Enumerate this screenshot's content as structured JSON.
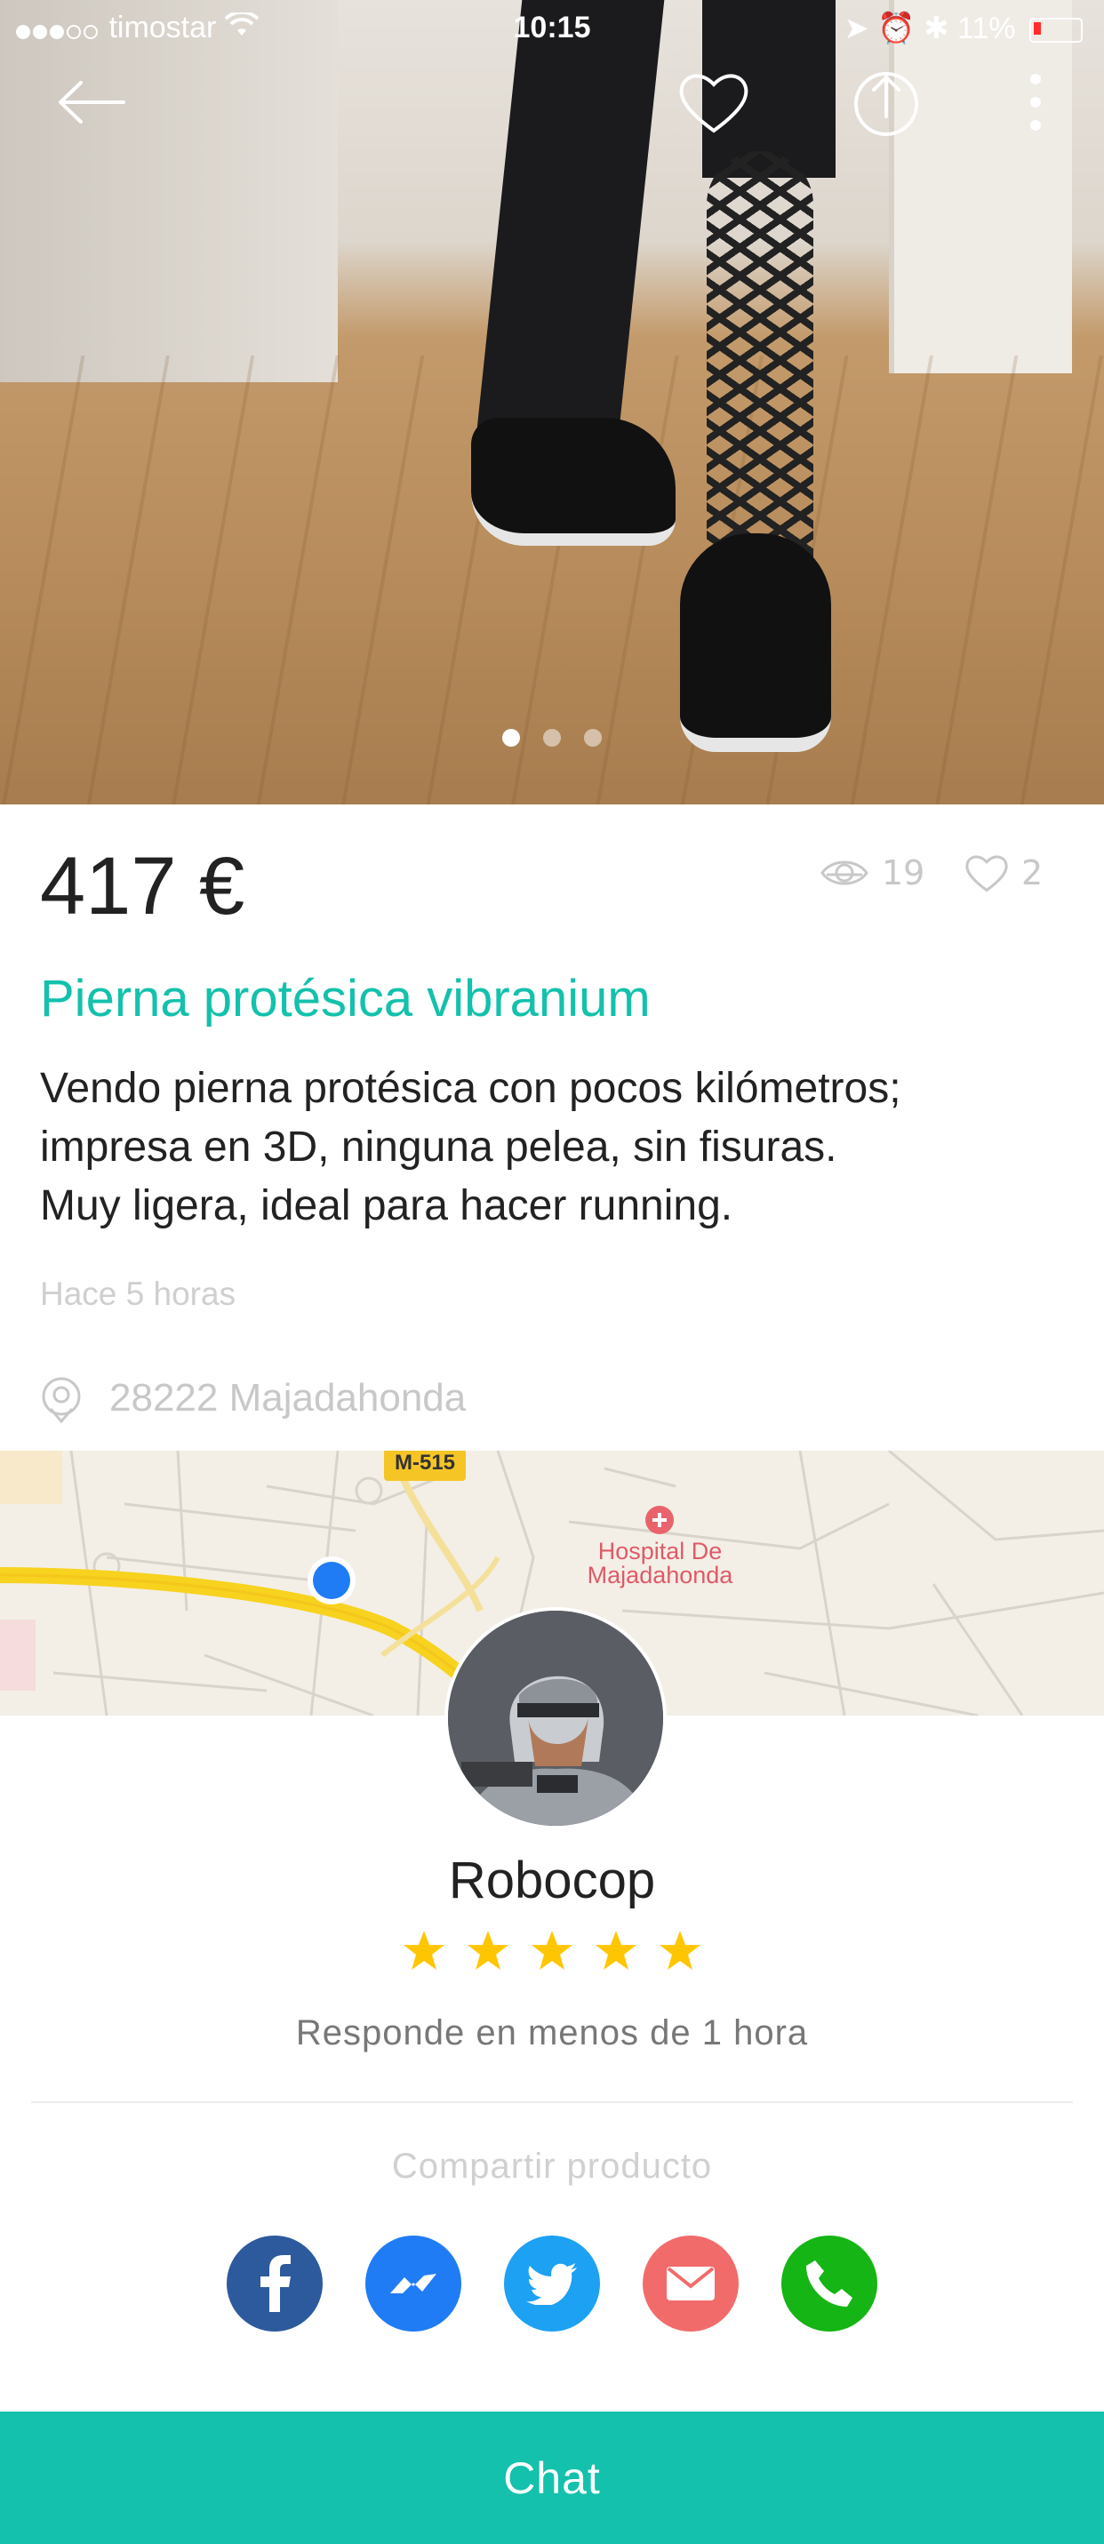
{
  "status_bar": {
    "carrier": "timostar",
    "time": "10:15",
    "battery": "11%"
  },
  "gallery": {
    "image_count": 3,
    "active_index": 0
  },
  "listing": {
    "price": "417 €",
    "views": "19",
    "likes": "2",
    "title": "Pierna protésica vibranium",
    "description_lines": [
      "Vendo pierna protésica con pocos kilómetros;",
      "impresa en 3D, ninguna pelea, sin fisuras.",
      "Muy ligera, ideal para hacer running."
    ],
    "posted": "Hace 5 horas",
    "location": "28222 Majadahonda"
  },
  "map": {
    "road_label": "M-515",
    "poi_line1": "Hospital De",
    "poi_line2": "Majadahonda"
  },
  "seller": {
    "name": "Robocop",
    "rating": 5,
    "max_rating": 5,
    "response": "Responde en menos de 1 hora"
  },
  "share": {
    "label": "Compartir producto",
    "buttons": [
      {
        "name": "facebook",
        "color": "#2d5a9c"
      },
      {
        "name": "messenger",
        "color": "#1f7cf5"
      },
      {
        "name": "twitter",
        "color": "#1da1f2"
      },
      {
        "name": "email",
        "color": "#f26b6b"
      },
      {
        "name": "phone",
        "color": "#14b514"
      }
    ]
  },
  "chat": {
    "label": "Chat"
  },
  "colors": {
    "accent": "#13c1ac",
    "star": "#fec600"
  }
}
